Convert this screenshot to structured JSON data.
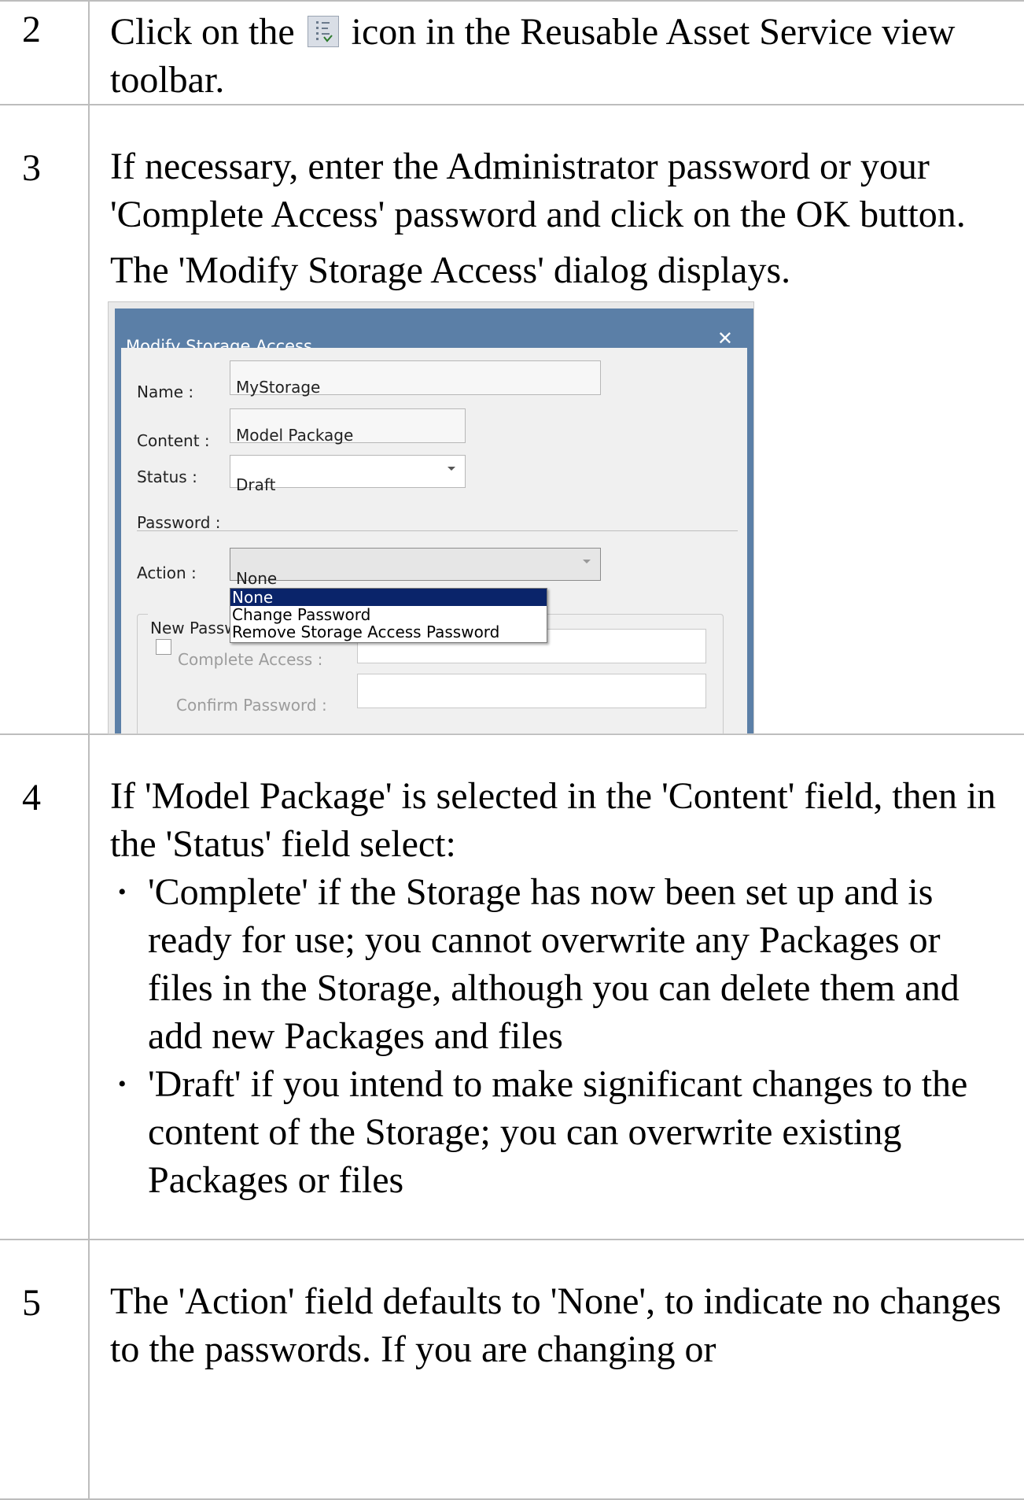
{
  "steps": [
    {
      "number": "2",
      "text_before_icon": "Click on the",
      "icon": "storage-access-toolbar-icon",
      "text_after_icon": "icon in the Reusable Asset Service view toolbar."
    },
    {
      "number": "3",
      "paragraph1": "If necessary, enter the Administrator password or your 'Complete Access' password and click on the OK button.",
      "paragraph2": "The 'Modify Storage Access' dialog displays."
    },
    {
      "number": "4",
      "intro": "If 'Model Package' is selected in the 'Content' field, then in the 'Status' field select:",
      "bullets": [
        "'Complete' if the Storage has now been set up and is ready for use; you cannot overwrite any Packages or files in the Storage, although you can delete them and add new Packages and files",
        "'Draft' if you intend to make significant changes to the content of the Storage; you can overwrite existing Packages or files"
      ]
    },
    {
      "number": "5",
      "text": "The 'Action' field defaults to 'None', to indicate no changes to the passwords. If you are changing or"
    }
  ],
  "dialog": {
    "title": "Modify Storage Access",
    "close": "✕",
    "name_label": "Name :",
    "name_value": "MyStorage",
    "content_label": "Content :",
    "content_value": "Model Package",
    "status_label": "Status :",
    "status_value": "Draft",
    "password_label": "Password :",
    "action_label": "Action :",
    "action_value": "None",
    "new_password_label": "New Passw",
    "complete_access_label": "Complete Access :",
    "confirm_password_label": "Confirm Password :",
    "dropdown_options": [
      "None",
      "Change Password",
      "Remove Storage Access Password"
    ],
    "dropdown_selected": "None"
  }
}
